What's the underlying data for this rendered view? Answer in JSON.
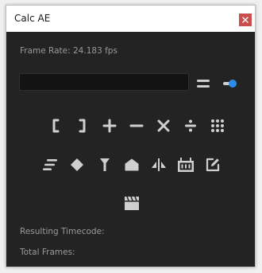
{
  "window": {
    "title": "Calc AE"
  },
  "frame_rate": {
    "label": "Frame Rate: 24.183 fps"
  },
  "input": {
    "value": "",
    "placeholder": ""
  },
  "results": {
    "timecode_label": "Resulting Timecode:",
    "frames_label": "Total Frames:"
  },
  "icons": {
    "close": "close-icon",
    "equals": "equals-icon",
    "toggle": "toggle-icon",
    "open_paren": "open-paren-icon",
    "close_paren": "close-paren-icon",
    "plus": "plus-icon",
    "minus": "minus-icon",
    "multiply": "multiply-icon",
    "divide": "divide-icon",
    "keypad": "keypad-icon",
    "align": "align-icon",
    "diamond": "diamond-icon",
    "pin": "pin-icon",
    "home": "home-icon",
    "split": "split-icon",
    "film": "film-icon",
    "edit": "edit-icon",
    "clapper": "clapper-icon"
  },
  "colors": {
    "panel_bg": "#232323",
    "icon": "#cfcfcf",
    "accent": "#2d8ceb",
    "close_bg": "#c94f4f"
  }
}
